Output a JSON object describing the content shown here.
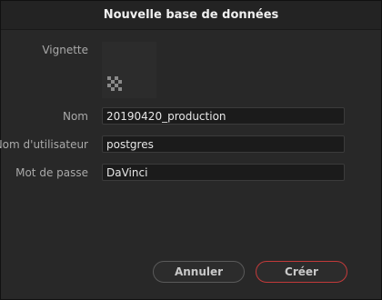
{
  "dialog": {
    "title": "Nouvelle base de données"
  },
  "form": {
    "thumbnail_label": "Vignette",
    "name_label": "Nom",
    "name_value": "20190420_production",
    "user_label": "Nom d'utilisateur",
    "user_value": "postgres",
    "password_label": "Mot de passe",
    "password_value": "DaVinci"
  },
  "buttons": {
    "cancel_label": "Annuler",
    "create_label": "Créer"
  },
  "colors": {
    "accent": "#c23a3a"
  },
  "icons": {
    "thumbnail_placeholder": "checkerboard-icon"
  }
}
